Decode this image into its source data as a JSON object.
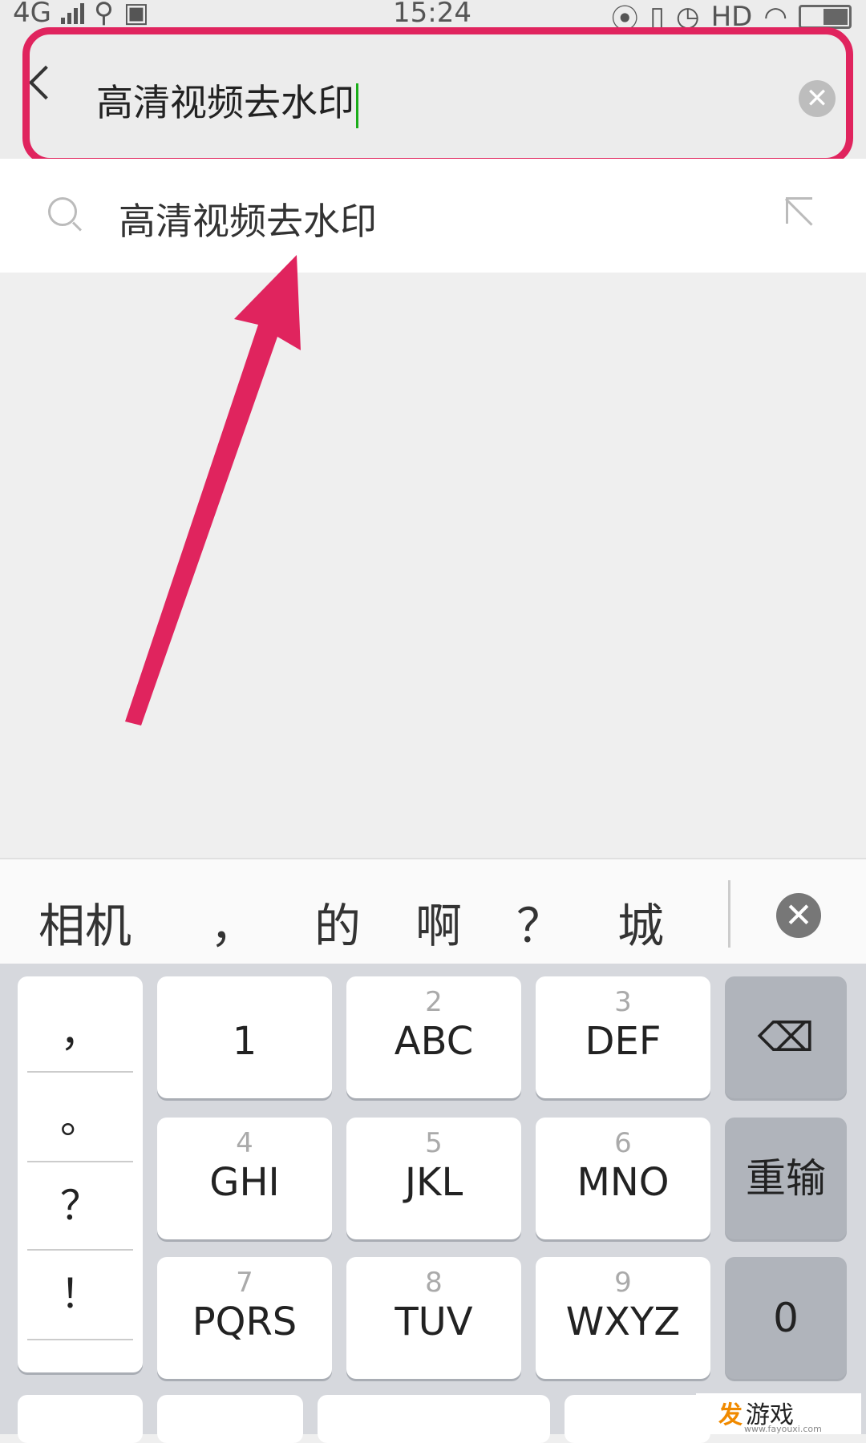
{
  "status": {
    "network": "4G",
    "time": "15:24",
    "hd": "HD"
  },
  "search": {
    "query": "高清视频去水印",
    "clear_glyph": "✕"
  },
  "suggestion": {
    "text": "高清视频去水印"
  },
  "annotation": {
    "color": "#e0245e"
  },
  "candidates": [
    "相机",
    "，",
    "的",
    "啊",
    "？",
    "城"
  ],
  "keypad": {
    "punct": [
      "，",
      "。",
      "？",
      "！"
    ],
    "rows": [
      [
        {
          "num": "",
          "letters": "1"
        },
        {
          "num": "2",
          "letters": "ABC"
        },
        {
          "num": "3",
          "letters": "DEF"
        }
      ],
      [
        {
          "num": "4",
          "letters": "GHI"
        },
        {
          "num": "5",
          "letters": "JKL"
        },
        {
          "num": "6",
          "letters": "MNO"
        }
      ],
      [
        {
          "num": "7",
          "letters": "PQRS"
        },
        {
          "num": "8",
          "letters": "TUV"
        },
        {
          "num": "9",
          "letters": "WXYZ"
        }
      ]
    ],
    "backspace_glyph": "⌫",
    "reinput": "重输",
    "zero": "0"
  },
  "watermark": {
    "brand": "发",
    "name": "游戏",
    "url": "www.fayouxi.com"
  }
}
